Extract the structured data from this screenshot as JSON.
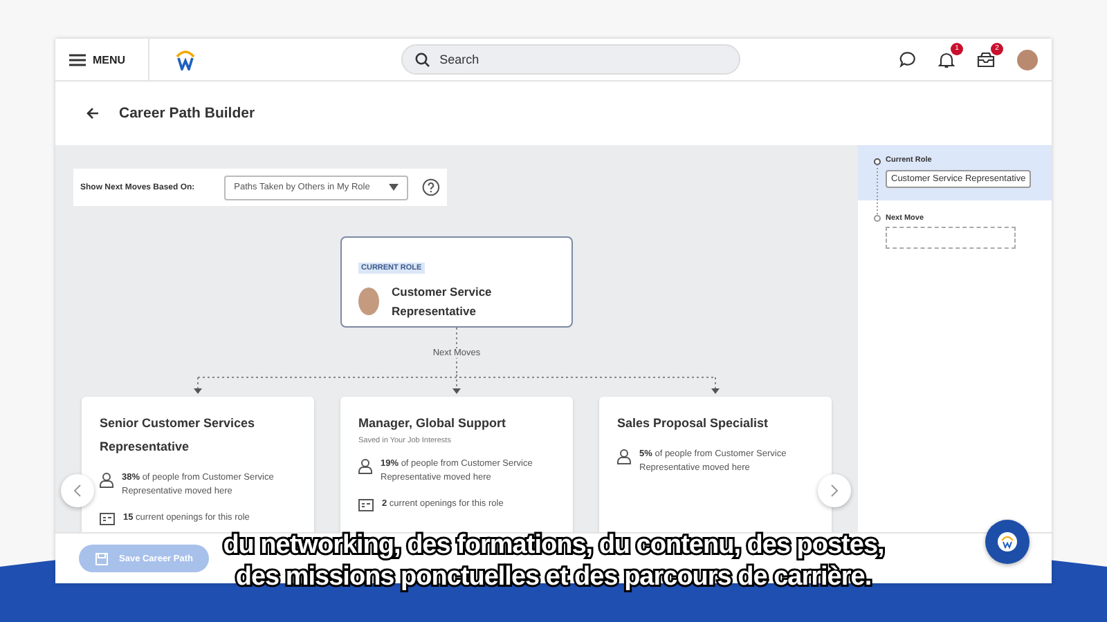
{
  "header": {
    "menu_label": "MENU",
    "search": {
      "placeholder": "Search"
    },
    "notifications_badge": "1",
    "inbox_badge": "2"
  },
  "page_title": "Career Path Builder",
  "filter": {
    "label": "Show Next Moves Based On:",
    "value": "Paths Taken by Others in My Role"
  },
  "current_role": {
    "tag": "CURRENT ROLE",
    "title": "Customer Service Representative"
  },
  "next_moves_label": "Next Moves",
  "cards": [
    {
      "title": "Senior Customer Services Representative",
      "stats": [
        {
          "kind": "people",
          "text": "**38%** of people from Customer Service Representative moved here"
        },
        {
          "kind": "openings",
          "text": "**15** current openings for this role"
        }
      ]
    },
    {
      "title": "Manager, Global Support",
      "note": "Saved in Your Job Interests",
      "stats": [
        {
          "kind": "people",
          "text": "**19%** of people from Customer Service Representative moved here"
        },
        {
          "kind": "openings",
          "text": "**2** current openings for this role"
        }
      ]
    },
    {
      "title": "Sales Proposal Specialist",
      "stats": [
        {
          "kind": "people",
          "text": "**5%** of people from Customer Service Representative moved here"
        }
      ]
    }
  ],
  "path_panel": {
    "current_label": "Current Role",
    "current_value": "Customer Service Representative",
    "next_label": "Next Move"
  },
  "footer": {
    "save_button": {
      "label": "Save Career Path",
      "disabled": true
    }
  },
  "caption_lines": [
    "du networking, des formations, du contenu, des postes,",
    "des missions ponctuelles et des parcours de carrière."
  ]
}
